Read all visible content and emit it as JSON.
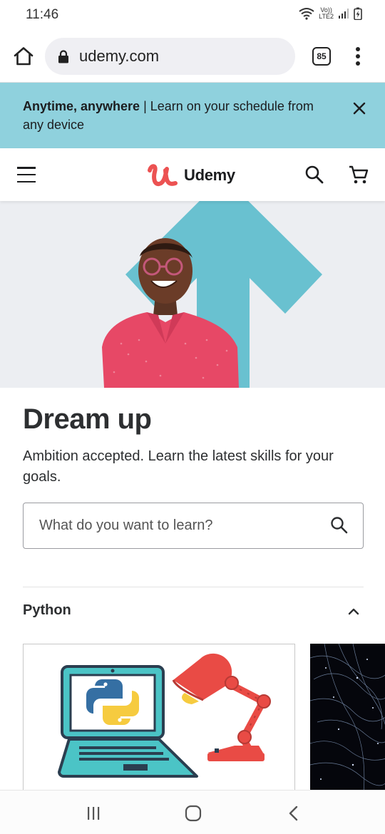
{
  "status_bar": {
    "time": "11:46",
    "network_label_top": "Vo))",
    "network_label_bottom": "LTE2"
  },
  "browser": {
    "url": "udemy.com",
    "tab_count": "85"
  },
  "promo_banner": {
    "title": "Anytime, anywhere",
    "separator": " | ",
    "message": "Learn on your schedule from any device",
    "background": "#8fd1dd"
  },
  "header": {
    "logo_text": "Udemy",
    "logo_color": "#ec5252"
  },
  "hero": {
    "title": "Dream up",
    "subtitle": "Ambition accepted. Learn the latest skills for your goals.",
    "accent_color": "#69c1d0"
  },
  "search": {
    "placeholder": "What do you want to learn?"
  },
  "section": {
    "title": "Python"
  },
  "icons": {
    "home": "home-icon",
    "lock": "lock-icon",
    "more": "more-vert-icon",
    "close": "close-icon",
    "menu": "hamburger-icon",
    "search": "search-icon",
    "cart": "cart-icon",
    "collapse": "chevron-up-icon",
    "recents": "recents-icon",
    "android_home": "android-home-icon",
    "back": "back-icon"
  }
}
